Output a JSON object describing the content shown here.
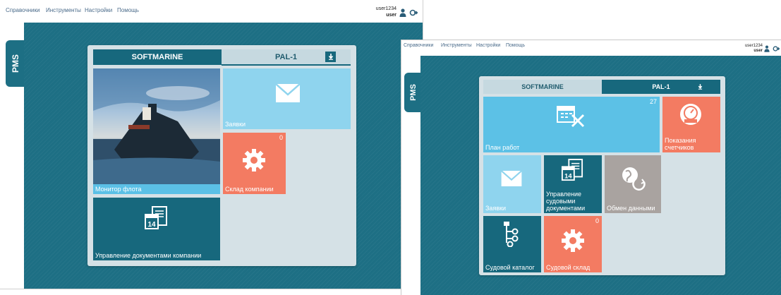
{
  "menu": {
    "items": [
      "Справочники",
      "Инструменты",
      "Настройки",
      "Помощь"
    ]
  },
  "user": {
    "name": "user1234",
    "role": "user"
  },
  "side_tab": "PMS",
  "tabs": {
    "company": "SOFTMARINE",
    "vessel": "PAL-1"
  },
  "window1": {
    "tiles": {
      "fleet_monitor": {
        "label": "Монитор флота"
      },
      "requests": {
        "label": "Заявки"
      },
      "company_warehouse": {
        "label": "Склад компании",
        "count": "0"
      },
      "company_docs": {
        "label": "Управление документами компании"
      }
    }
  },
  "window2": {
    "tiles": {
      "work_plan": {
        "label": "План работ",
        "count": "27"
      },
      "meter_readings": {
        "label": "Показания счетчиков"
      },
      "requests": {
        "label": "Заявки"
      },
      "vessel_docs": {
        "label": "Управление судовыми документами"
      },
      "data_exchange": {
        "label": "Обмен данными"
      },
      "ship_catalog": {
        "label": "Судовой каталог"
      },
      "ship_warehouse": {
        "label": "Судовой склад",
        "count": "0"
      }
    }
  },
  "colors": {
    "stage": "#1d6f84",
    "panel": "#d5e1e6",
    "teal_tile": "#17687d",
    "sky_tile": "#8fd4ee",
    "coral_tile": "#f37b62",
    "gray_tile": "#a9a3a0"
  }
}
